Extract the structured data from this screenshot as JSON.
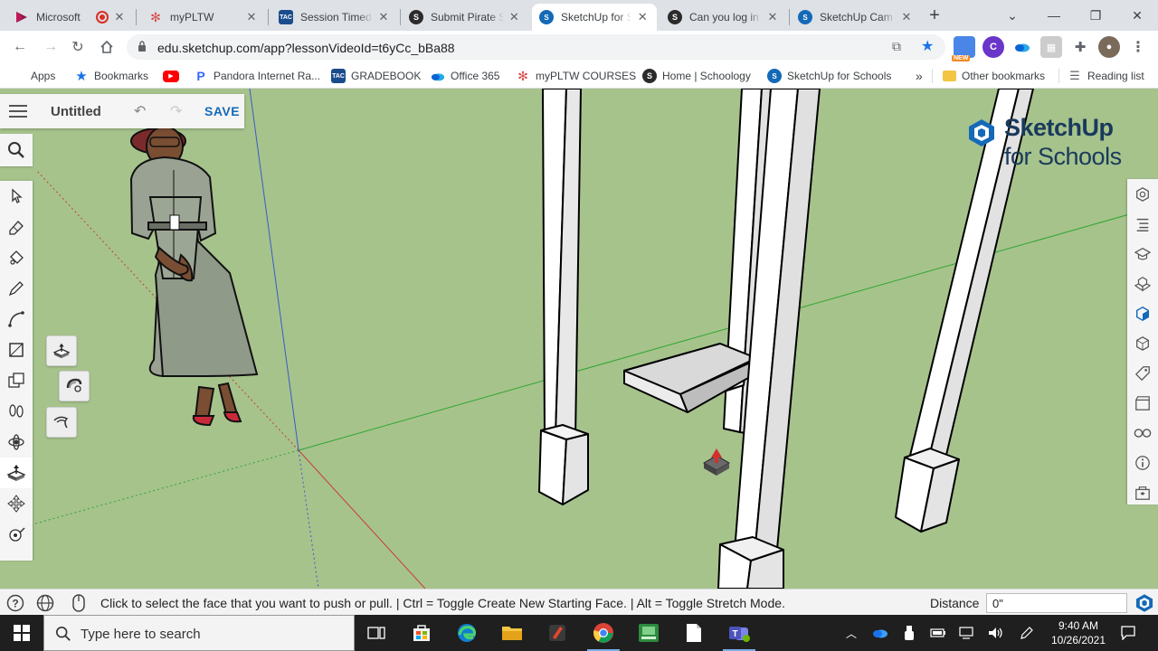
{
  "browser": {
    "tabs": [
      {
        "title": "Microsoft",
        "icon": "powerapps-icon",
        "color": "#8b1a4a"
      },
      {
        "title": "myPLTW",
        "icon": "pltw-icon",
        "color": "#d84b4b"
      },
      {
        "title": "Session Timed",
        "icon": "tac-icon",
        "color": "#1a4c8c"
      },
      {
        "title": "Submit Pirate S",
        "icon": "schoology-icon",
        "color": "#1f1f1f"
      },
      {
        "title": "SketchUp for S",
        "icon": "sketchup-icon",
        "color": "#1469b8"
      },
      {
        "title": "Can you log in",
        "icon": "schoology-icon",
        "color": "#1f1f1f"
      },
      {
        "title": "SketchUp Cam",
        "icon": "sketchup-icon",
        "color": "#1469b8"
      }
    ],
    "url": "edu.sketchup.com/app?lessonVideoId=t6yCc_bBa88",
    "extensions": {
      "new_badge": "NEW",
      "c_label": "C"
    },
    "bookmarks": [
      {
        "label": "Apps",
        "icon": "apps-grid-icon",
        "color": "#4285f4"
      },
      {
        "label": "Bookmarks",
        "icon": "star-icon",
        "color": "#1a73e8"
      },
      {
        "label": "",
        "icon": "youtube-icon",
        "color": "#ff0000"
      },
      {
        "label": "Pandora Internet Ra...",
        "icon": "pandora-icon",
        "color": "#3668ff"
      },
      {
        "label": "GRADEBOOK",
        "icon": "tac-icon",
        "color": "#1a4c8c"
      },
      {
        "label": "Office 365",
        "icon": "onedrive-icon",
        "color": "#0a64d6"
      },
      {
        "label": "myPLTW COURSES",
        "icon": "pltw-icon",
        "color": "#d84b4b"
      },
      {
        "label": "Home | Schoology",
        "icon": "schoology-icon",
        "color": "#1f1f1f"
      },
      {
        "label": "SketchUp for Schools",
        "icon": "sketchup-icon",
        "color": "#1469b8"
      }
    ],
    "more_bookmarks": "»",
    "other_bookmarks": "Other bookmarks",
    "reading_list": "Reading list"
  },
  "app": {
    "doc_title": "Untitled",
    "save_label": "SAVE",
    "brand_line1": "SketchUp",
    "brand_line2": "for Schools",
    "left_tools": [
      "select-arrow-icon",
      "eraser-icon",
      "paint-bucket-icon",
      "pencil-icon",
      "arc-icon",
      "rectangle-icon",
      "push-pull-icon",
      "offset-icon",
      "move-icon",
      "tape-measure-icon",
      "footprints-icon",
      "orbit-icon"
    ],
    "selected_tool": "push-pull-icon",
    "right_tools": [
      "instructor-icon",
      "outliner-icon",
      "learn-icon",
      "components-icon",
      "materials-icon",
      "styles-icon",
      "tags-icon",
      "scenes-icon",
      "display-icon",
      "info-icon",
      "3d-warehouse-icon"
    ],
    "status_message": "Click to select the face that you want to push or pull. | Ctrl = Toggle Create New Starting Face. | Alt = Toggle Stretch Mode.",
    "distance_label": "Distance",
    "distance_value": "0\""
  },
  "taskbar": {
    "search_placeholder": "Type here to search",
    "time": "9:40 AM",
    "date": "10/26/2021"
  },
  "colors": {
    "ground": "#a6c38c",
    "accent_blue": "#1469b8",
    "axis_green": "#2fa52f",
    "axis_red": "#c83c3c",
    "axis_blue": "#3c5ac8"
  }
}
